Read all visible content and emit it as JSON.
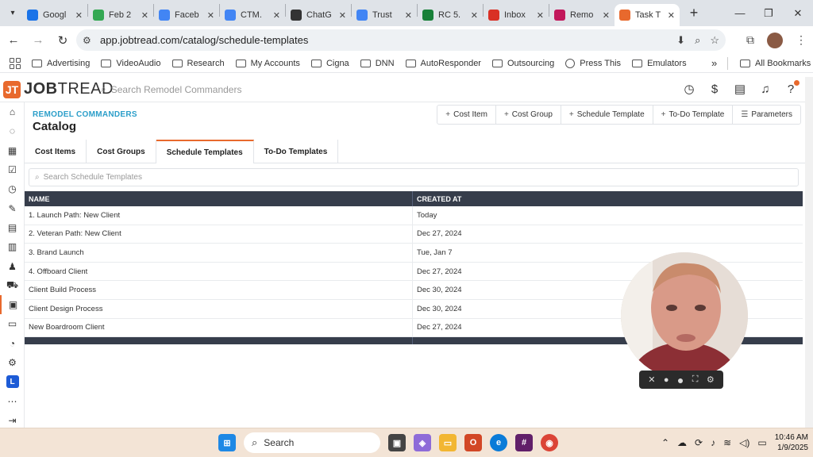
{
  "browser": {
    "tabs": [
      {
        "label": "Googl",
        "color": "#1a73e8",
        "active": false
      },
      {
        "label": "Feb 2",
        "color": "#34a853",
        "active": false
      },
      {
        "label": "Faceb",
        "color": "#4285f4",
        "active": false
      },
      {
        "label": "CTM.",
        "color": "#4285f4",
        "active": false
      },
      {
        "label": "ChatG",
        "color": "#333333",
        "active": false
      },
      {
        "label": "Trust",
        "color": "#4285f4",
        "active": false
      },
      {
        "label": "RC 5.",
        "color": "#188038",
        "active": false
      },
      {
        "label": "Inbox",
        "color": "#d93025",
        "active": false
      },
      {
        "label": "Remo",
        "color": "#c2185b",
        "active": false
      },
      {
        "label": "Task T",
        "color": "#e8692d",
        "active": true
      }
    ],
    "url": "app.jobtread.com/catalog/schedule-templates",
    "bookmarks": [
      {
        "label": "Advertising",
        "type": "folder"
      },
      {
        "label": "VideoAudio",
        "type": "folder"
      },
      {
        "label": "Research",
        "type": "folder"
      },
      {
        "label": "My Accounts",
        "type": "folder"
      },
      {
        "label": "Cigna",
        "type": "folder"
      },
      {
        "label": "DNN",
        "type": "folder"
      },
      {
        "label": "AutoResponder",
        "type": "folder"
      },
      {
        "label": "Outsourcing",
        "type": "folder"
      },
      {
        "label": "Press This",
        "type": "globe"
      },
      {
        "label": "Emulators",
        "type": "folder"
      }
    ],
    "more_bookmarks": "»",
    "all_bookmarks": "All Bookmarks"
  },
  "app": {
    "logo_mark": "JT",
    "logo_bold": "JOB",
    "logo_rest": "TREAD",
    "search_placeholder": "Search Remodel Commanders",
    "org_name": "REMODEL COMMANDERS",
    "page_title": "Catalog",
    "actions": [
      {
        "label": "Cost Item",
        "icon": "+"
      },
      {
        "label": "Cost Group",
        "icon": "+"
      },
      {
        "label": "Schedule Template",
        "icon": "+"
      },
      {
        "label": "To-Do Template",
        "icon": "+"
      },
      {
        "label": "Parameters",
        "icon": "☰"
      }
    ],
    "tabs": [
      {
        "label": "Cost Items",
        "active": false
      },
      {
        "label": "Cost Groups",
        "active": false
      },
      {
        "label": "Schedule Templates",
        "active": true
      },
      {
        "label": "To-Do Templates",
        "active": false
      }
    ],
    "table_search_placeholder": "Search Schedule Templates",
    "columns": [
      "NAME",
      "CREATED AT"
    ],
    "rows": [
      {
        "name": "1. Launch Path: New Client",
        "created": "Today"
      },
      {
        "name": "2. Veteran Path: New Client",
        "created": "Dec 27, 2024"
      },
      {
        "name": "3. Brand Launch",
        "created": "Tue, Jan 7"
      },
      {
        "name": "4. Offboard Client",
        "created": "Dec 27, 2024"
      },
      {
        "name": "Client Build Process",
        "created": "Dec 30, 2024"
      },
      {
        "name": "Client Design Process",
        "created": "Dec 30, 2024"
      },
      {
        "name": "New Boardroom Client",
        "created": "Dec 27, 2024"
      }
    ],
    "sidebar_badge": "L",
    "accent": "#e8692d",
    "header_dark": "#363d4b"
  },
  "taskbar": {
    "search_label": "Search",
    "time": "10:46 AM",
    "date": "1/9/2025"
  }
}
